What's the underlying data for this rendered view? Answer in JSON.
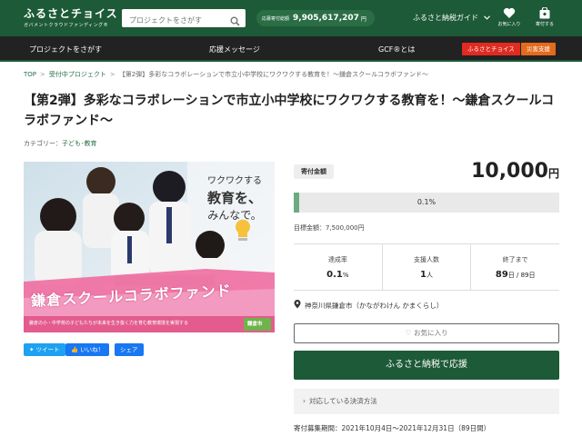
{
  "header": {
    "logo_main": "ふるさとチョイス",
    "logo_sub": "ガバメントクラウドファンディング®",
    "search_placeholder": "プロジェクトをさがす",
    "donation_label": "応募寄付総額",
    "donation_amount": "9,905,617,207",
    "donation_unit": "円",
    "guide_label": "ふるさと納税ガイド",
    "favorites_label": "お気に入り",
    "donate_label": "寄付する"
  },
  "nav": {
    "find_projects": "プロジェクトをさがす",
    "support_messages": "応援メッセージ",
    "gcf_about": "GCF®とは",
    "furusato_choice": "ふるさとチョイス",
    "disaster_support": "災害支援"
  },
  "breadcrumb": {
    "top": "TOP",
    "accepting": "受付中プロジェクト",
    "current": "【第2弾】多彩なコラボレーションで市立小中学校にワクワクする教育を！〜鎌倉スクールコラボファンド〜"
  },
  "project": {
    "title": "【第2弾】多彩なコラボレーションで市立小中学校にワクワクする教育を！〜鎌倉スクールコラボファンド〜",
    "category_label": "カテゴリー：",
    "category_value": "子ども･教育"
  },
  "hero": {
    "headline_1": "ワクワクする",
    "headline_2": "教育を、",
    "headline_3": "みんなで。",
    "fund_name": "鎌倉スクールコラボファンド",
    "caption": "鎌倉の小・中学校の子どもたちが未来を生き抜く力を育む教育環境を実現する",
    "city": "鎌倉市"
  },
  "share": {
    "tweet": "ツイート",
    "like": "いいね！",
    "share": "シェア"
  },
  "funding": {
    "badge": "寄付金額",
    "amount": "10,000",
    "amount_unit": "円",
    "progress_label": "0.1%",
    "progress_ratio": 0.001,
    "target_label": "目標金額：",
    "target_value": "7,500,000円"
  },
  "stats": [
    {
      "label": "達成率",
      "value": "0.1",
      "unit": "%"
    },
    {
      "label": "支援人数",
      "value": "1",
      "unit": "人"
    },
    {
      "label": "終了まで",
      "value": "89",
      "unit": "日 / 89日"
    }
  ],
  "location": "神奈川県鎌倉市（かながわけん かまくらし）",
  "buttons": {
    "favorite": "お気に入り",
    "donate": "ふるさと納税で応援",
    "payment": "対応している決済方法"
  },
  "period": {
    "label": "寄付募集期間：",
    "value": "2021年10月4日〜2021年12月31日（89日間）"
  },
  "colors": {
    "brand_green": "#1d5a37",
    "nav_dark": "#222222",
    "red_button": "#e02b20"
  }
}
